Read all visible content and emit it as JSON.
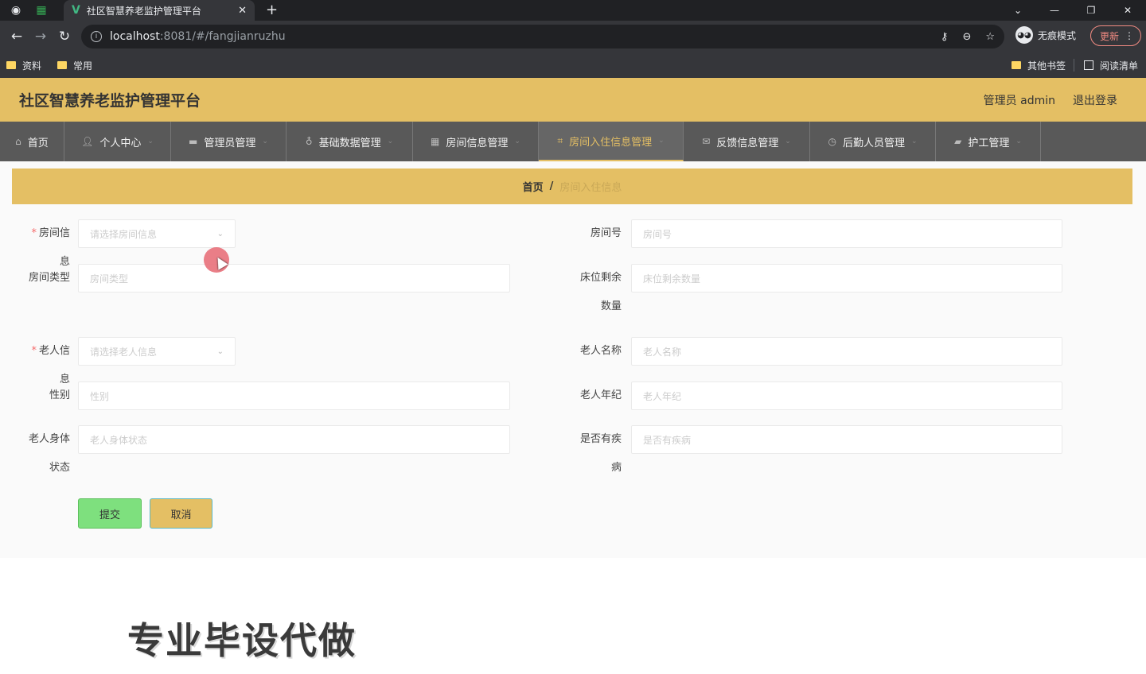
{
  "browser": {
    "tab_title": "社区智慧养老监护管理平台",
    "url_host": "localhost",
    "url_rest": ":8081/#/fangjianruzhu",
    "incognito_label": "无痕模式",
    "update_label": "更新",
    "bookmarks": [
      "资料",
      "常用"
    ],
    "bookmarks_right": [
      "其他书签",
      "阅读清单"
    ]
  },
  "header": {
    "title": "社区智慧养老监护管理平台",
    "user_label": "管理员 admin",
    "logout_label": "退出登录"
  },
  "menu": [
    {
      "label": "首页",
      "icon": "home-icon"
    },
    {
      "label": "个人中心",
      "icon": "user-icon"
    },
    {
      "label": "管理员管理",
      "icon": "admin-icon"
    },
    {
      "label": "基础数据管理",
      "icon": "mic-icon"
    },
    {
      "label": "房间信息管理",
      "icon": "grid-icon"
    },
    {
      "label": "房间入住信息管理",
      "icon": "crop-icon",
      "active": true
    },
    {
      "label": "反馈信息管理",
      "icon": "mail-icon"
    },
    {
      "label": "后勤人员管理",
      "icon": "clock-icon"
    },
    {
      "label": "护工管理",
      "icon": "lock-icon"
    }
  ],
  "breadcrumb": {
    "home": "首页",
    "separator": "/",
    "current": "房间入住信息"
  },
  "form": {
    "room_info": {
      "label": "房间信息",
      "placeholder": "请选择房间信息"
    },
    "room_number": {
      "label": "房间号",
      "placeholder": "房间号"
    },
    "room_type": {
      "label": "房间类型",
      "placeholder": "房间类型"
    },
    "beds_remaining": {
      "label_line1": "床位剩余",
      "label_line2": "数量",
      "placeholder": "床位剩余数量"
    },
    "elder_info": {
      "label": "老人信息",
      "placeholder": "请选择老人信息"
    },
    "elder_name": {
      "label": "老人名称",
      "placeholder": "老人名称"
    },
    "gender": {
      "label": "性别",
      "placeholder": "性别"
    },
    "elder_age": {
      "label": "老人年纪",
      "placeholder": "老人年纪"
    },
    "elder_health": {
      "label_line1": "老人身体",
      "label_line2": "状态",
      "placeholder": "老人身体状态"
    },
    "has_disease": {
      "label_line1": "是否有疾",
      "label_line2": "病",
      "placeholder": "是否有疾病"
    },
    "submit_label": "提交",
    "cancel_label": "取消"
  },
  "watermark": "专业毕设代做",
  "colors": {
    "accent": "#e4bf64",
    "menu_bg": "#595959",
    "submit": "#7ee07e"
  }
}
